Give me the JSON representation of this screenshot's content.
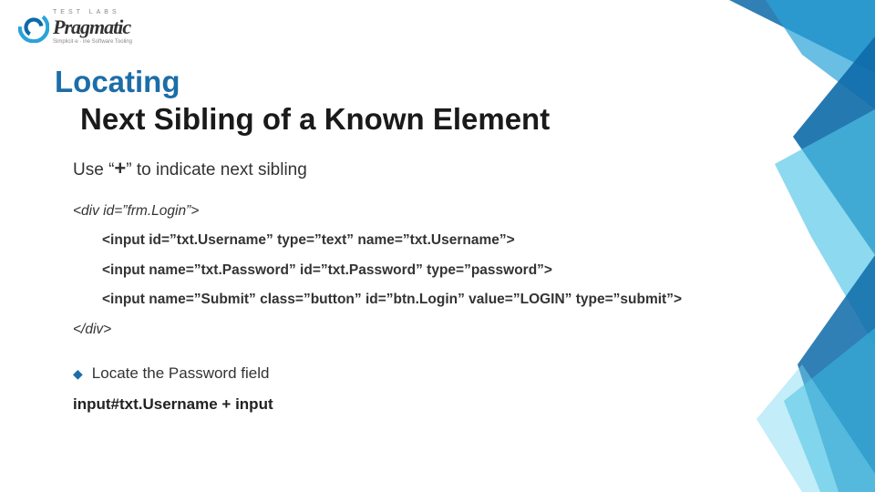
{
  "logo": {
    "top": "TEST  LABS",
    "main": "Pragmatic",
    "sub": "Simplicit·e · ine Software Tooling"
  },
  "title": {
    "line1": "Locating",
    "line2": "Next Sibling of a Known Element"
  },
  "subtitle": {
    "pre": "Use “",
    "plus": "+",
    "post": "” to indicate next sibling"
  },
  "code": {
    "open": "<div id=”frm.Login”>",
    "l1": "<input id=”txt.Username” type=”text” name=”txt.Username”>",
    "l2": "<input name=”txt.Password” id=”txt.Password” type=”password”>",
    "l3": "<input name=”Submit” class=”button” id=”btn.Login” value=”LOGIN” type=”submit”>",
    "close": "</div>"
  },
  "bullet": {
    "text": "Locate the Password field"
  },
  "selector": "input#txt.Username + input"
}
